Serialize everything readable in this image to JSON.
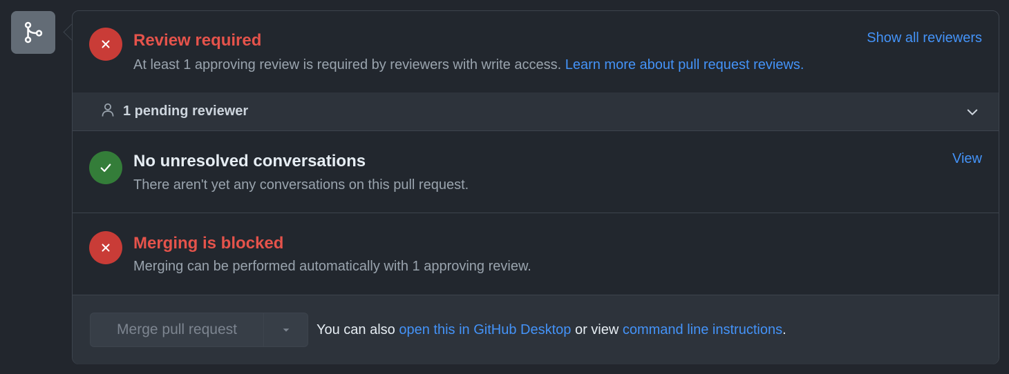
{
  "review": {
    "title": "Review required",
    "desc_prefix": "At least 1 approving review is required by reviewers with write access. ",
    "desc_link": "Learn more about pull request reviews.",
    "right_link": "Show all reviewers"
  },
  "pending": {
    "label": "1 pending reviewer"
  },
  "conversations": {
    "title": "No unresolved conversations",
    "desc": "There aren't yet any conversations on this pull request.",
    "right_link": "View"
  },
  "merge_status": {
    "title": "Merging is blocked",
    "desc": "Merging can be performed automatically with 1 approving review."
  },
  "actions": {
    "merge_button": "Merge pull request",
    "text_prefix": "You can also ",
    "desktop_link": "open this in GitHub Desktop",
    "text_middle": " or view ",
    "cli_link": "command line instructions",
    "text_suffix": "."
  },
  "icons": {
    "badge": "git-merge-icon",
    "fail": "x-icon",
    "pass": "check-icon",
    "person": "person-icon",
    "chevron": "chevron-down-icon",
    "dropdown": "triangle-down-icon"
  },
  "colors": {
    "fail": "#e5534b",
    "fail_circle": "#c93c37",
    "pass_circle": "#347d39",
    "link": "#4493f8"
  }
}
